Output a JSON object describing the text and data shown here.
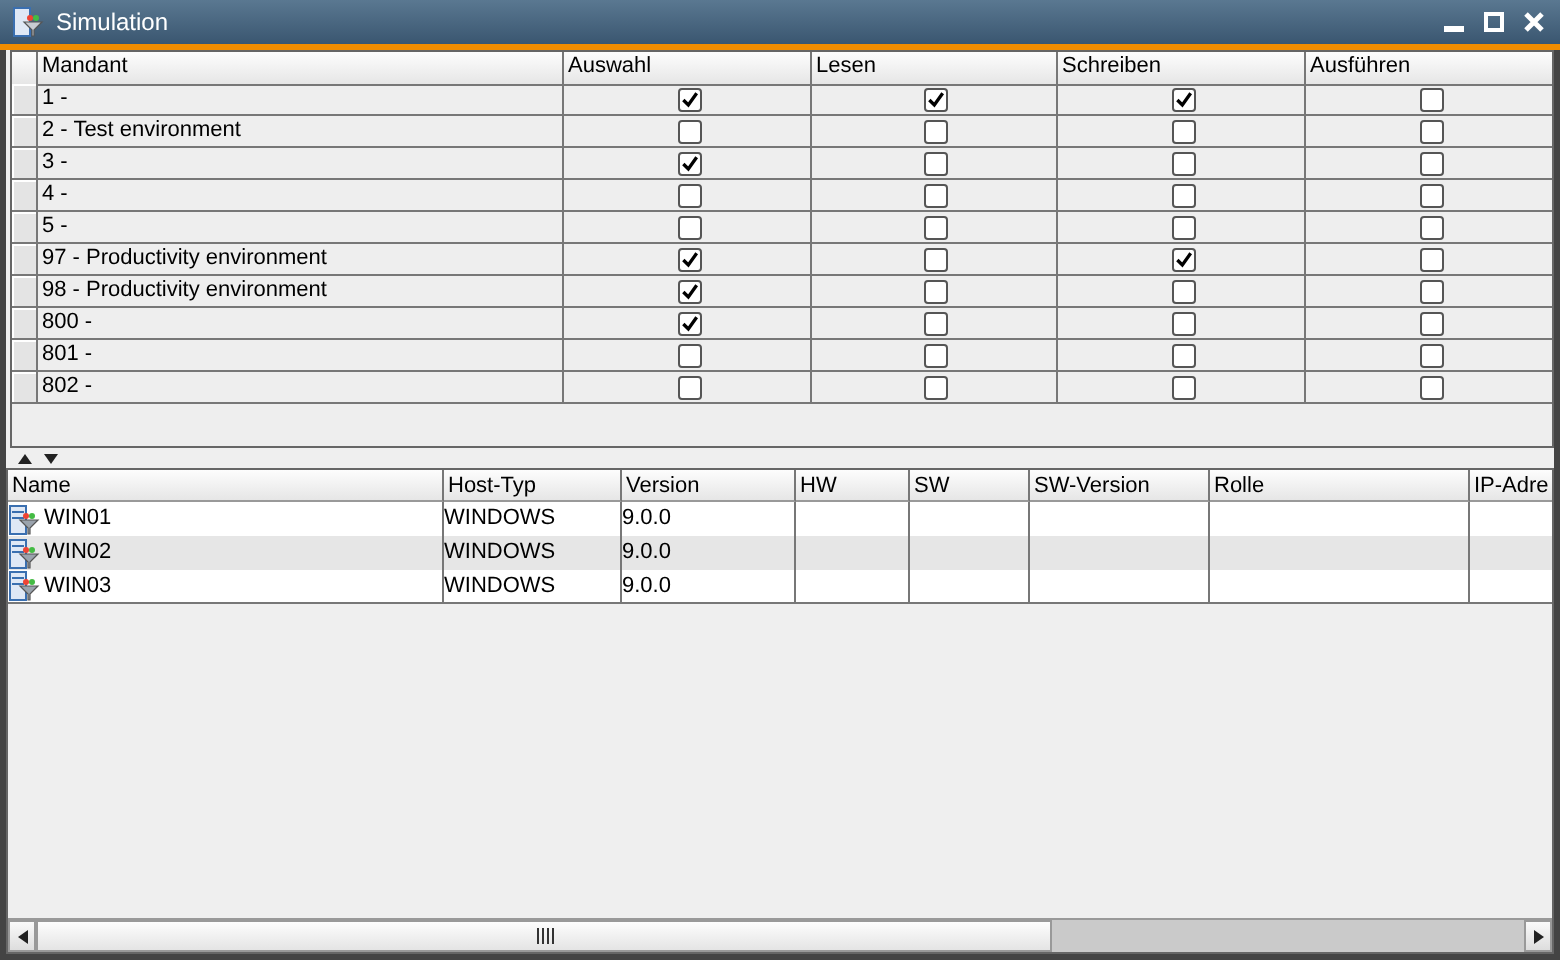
{
  "window": {
    "title": "Simulation"
  },
  "clients_table": {
    "columns": [
      "Mandant",
      "Auswahl",
      "Lesen",
      "Schreiben",
      "Ausführen"
    ],
    "rows": [
      {
        "name": "1 -",
        "checks": [
          true,
          true,
          true,
          false
        ]
      },
      {
        "name": "2 - Test environment",
        "checks": [
          false,
          false,
          false,
          false
        ]
      },
      {
        "name": "3 -",
        "checks": [
          true,
          false,
          false,
          false
        ]
      },
      {
        "name": "4 -",
        "checks": [
          false,
          false,
          false,
          false
        ]
      },
      {
        "name": "5 -",
        "checks": [
          false,
          false,
          false,
          false
        ]
      },
      {
        "name": "97 - Productivity environment",
        "checks": [
          true,
          false,
          true,
          false
        ]
      },
      {
        "name": "98 - Productivity environment",
        "checks": [
          true,
          false,
          false,
          false
        ]
      },
      {
        "name": "800 -",
        "checks": [
          true,
          false,
          false,
          false
        ]
      },
      {
        "name": "801 -",
        "checks": [
          false,
          false,
          false,
          false
        ]
      },
      {
        "name": "802 -",
        "checks": [
          false,
          false,
          false,
          false
        ]
      }
    ]
  },
  "hosts_table": {
    "columns": [
      "Name",
      "Host-Typ",
      "Version",
      "HW",
      "SW",
      "SW-Version",
      "Rolle",
      "IP-Adre"
    ],
    "rows": [
      {
        "name": "WIN01",
        "host_type": "WINDOWS",
        "version": "9.0.0"
      },
      {
        "name": "WIN02",
        "host_type": "WINDOWS",
        "version": "9.0.0"
      },
      {
        "name": "WIN03",
        "host_type": "WINDOWS",
        "version": "9.0.0"
      }
    ]
  }
}
